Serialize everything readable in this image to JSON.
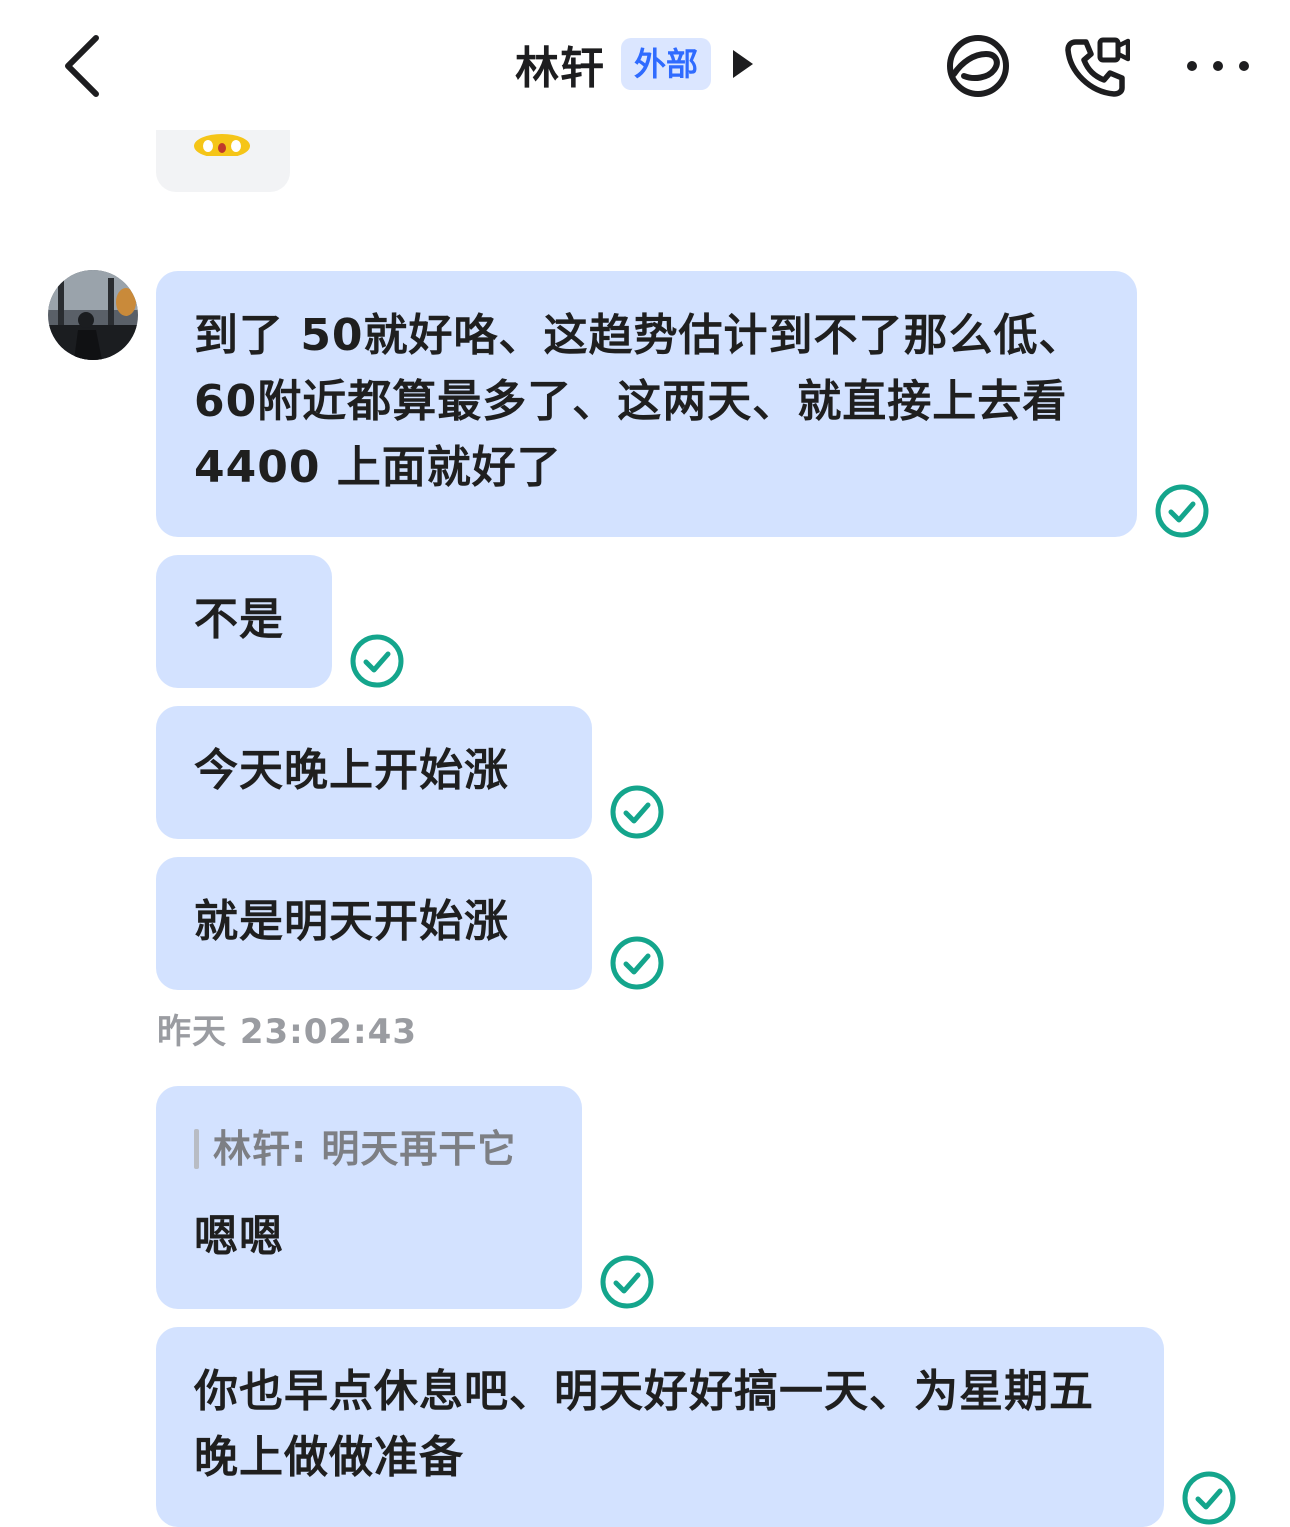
{
  "header": {
    "title": "林轩",
    "badge": "外部",
    "icons": [
      "back-chevron-icon",
      "moments-icon",
      "voice-video-call-icon",
      "more-dots-icon"
    ]
  },
  "messages": [
    {
      "type": "sticker",
      "icon": "emoji-sticker",
      "status": "none"
    },
    {
      "type": "text",
      "text": "到了 50就好咯、这趋势估计到不了那么低、60附近都算最多了、这两天、就直接上去看 4400 上面就好了",
      "status": "read"
    },
    {
      "type": "text",
      "text": "不是",
      "status": "read"
    },
    {
      "type": "text",
      "text": "今天晚上开始涨",
      "status": "read"
    },
    {
      "type": "text",
      "text": "就是明天开始涨",
      "status": "read"
    },
    {
      "type": "timestamp",
      "text": "昨天 23:02:43"
    },
    {
      "type": "reply",
      "quote": "林轩: 明天再干它",
      "text": "嗯嗯",
      "status": "read"
    },
    {
      "type": "text",
      "text": "你也早点休息吧、明天好好搞一天、为星期五晚上做做准备",
      "status": "read"
    }
  ],
  "colors": {
    "bubble": "#d3e2ff",
    "read_check": "#14a58c",
    "badge_bg": "#dbe6ff",
    "badge_text": "#2f6bff"
  }
}
